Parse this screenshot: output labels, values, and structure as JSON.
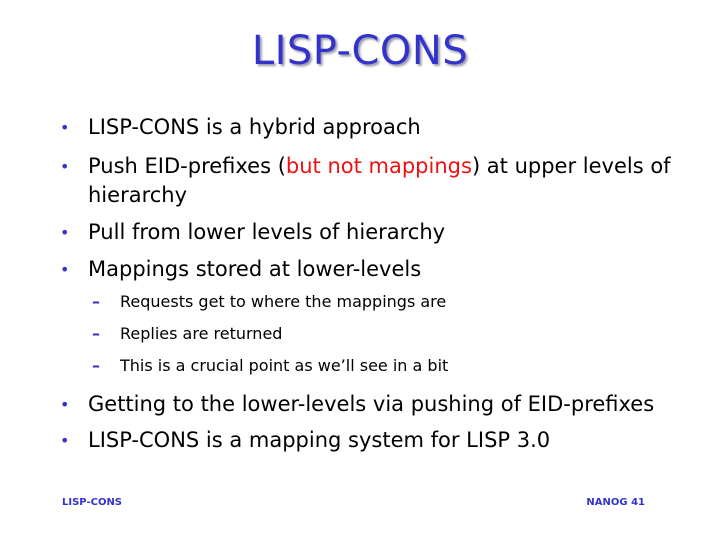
{
  "slide": {
    "title": "LISP-CONS",
    "bullets": [
      {
        "text": "LISP-CONS is a hybrid approach"
      },
      {
        "before": "Push EID-prefixes (",
        "highlight": "but not mappings",
        "after": ") at upper levels of",
        "continuation": "hierarchy"
      },
      {
        "text": "Pull from lower levels of hierarchy"
      },
      {
        "text": "Mappings stored at lower-levels"
      },
      {
        "text": "Getting to the lower-levels via pushing of EID-prefixes"
      },
      {
        "text": "LISP-CONS is a mapping system for LISP 3.0"
      }
    ],
    "sub_bullets": [
      {
        "text": "Requests get to where the mappings are"
      },
      {
        "text": "Replies are returned"
      },
      {
        "text": "This is a crucial point as we’ll see in a bit"
      }
    ],
    "footer_left": "LISP-CONS",
    "footer_right": "NANOG 41",
    "colors": {
      "title": "#3333cc",
      "bullet": "#3333cc",
      "highlight": "#ee1111",
      "text": "#000000"
    },
    "icons": {
      "bullet": "•",
      "sub_bullet": "–"
    }
  }
}
